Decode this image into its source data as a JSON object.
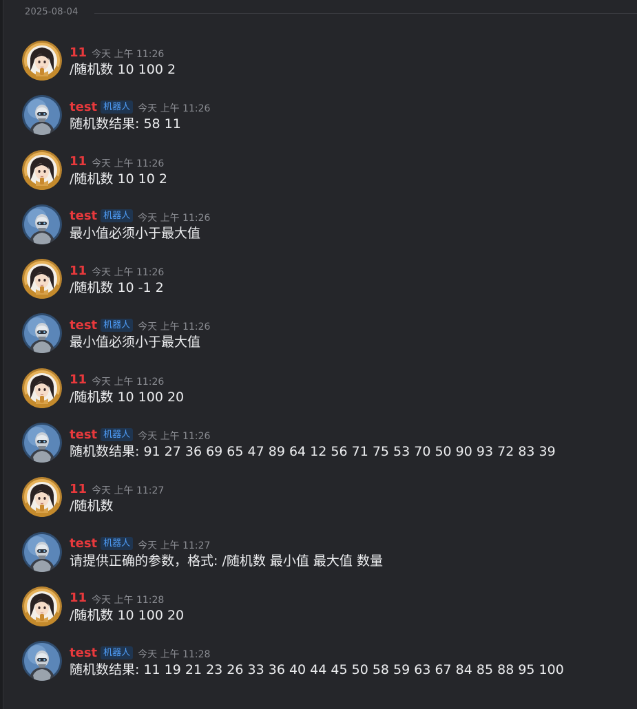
{
  "date_divider": "2025-08-04",
  "messages": [
    {
      "author": "11",
      "type": "user",
      "badge": "",
      "time": "今天 上午 11:26",
      "text": "/随机数 10 100 2"
    },
    {
      "author": "test",
      "type": "bot",
      "badge": "机器人",
      "time": "今天 上午 11:26",
      "text": "随机数结果: 58 11"
    },
    {
      "author": "11",
      "type": "user",
      "badge": "",
      "time": "今天 上午 11:26",
      "text": "/随机数 10 10 2"
    },
    {
      "author": "test",
      "type": "bot",
      "badge": "机器人",
      "time": "今天 上午 11:26",
      "text": "最小值必须小于最大值"
    },
    {
      "author": "11",
      "type": "user",
      "badge": "",
      "time": "今天 上午 11:26",
      "text": "/随机数 10 -1 2"
    },
    {
      "author": "test",
      "type": "bot",
      "badge": "机器人",
      "time": "今天 上午 11:26",
      "text": "最小值必须小于最大值"
    },
    {
      "author": "11",
      "type": "user",
      "badge": "",
      "time": "今天 上午 11:26",
      "text": "/随机数 10 100 20"
    },
    {
      "author": "test",
      "type": "bot",
      "badge": "机器人",
      "time": "今天 上午 11:26",
      "text": "随机数结果: 91 27 36 69 65 47 89 64 12 56 71 75 53 70 50 90 93 72 83 39"
    },
    {
      "author": "11",
      "type": "user",
      "badge": "",
      "time": "今天 上午 11:27",
      "text": "/随机数"
    },
    {
      "author": "test",
      "type": "bot",
      "badge": "机器人",
      "time": "今天 上午 11:27",
      "text": "请提供正确的参数，格式: /随机数 最小值 最大值 数量"
    },
    {
      "author": "11",
      "type": "user",
      "badge": "",
      "time": "今天 上午 11:28",
      "text": "/随机数 10 100 20"
    },
    {
      "author": "test",
      "type": "bot",
      "badge": "机器人",
      "time": "今天 上午 11:28",
      "text": "随机数结果: 11 19 21 23 26 33 36 40 44 45 50 58 59 63 67 84 85 88 95 100"
    }
  ],
  "colors": {
    "author": "#e8393c",
    "badge_text": "#4f9df7",
    "background": "#25262a"
  },
  "icons": {
    "user_avatar": "anime-girl-avatar-icon",
    "bot_avatar": "robot-avatar-icon"
  }
}
